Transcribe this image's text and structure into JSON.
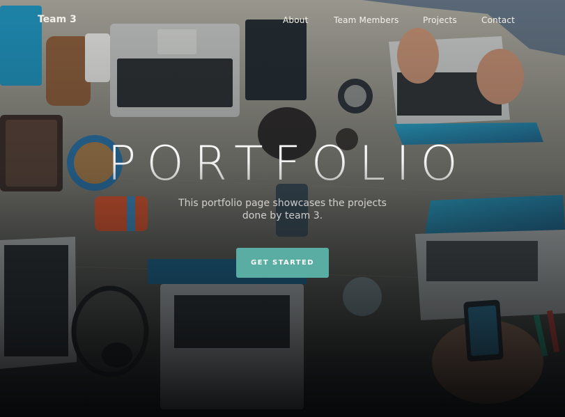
{
  "nav": {
    "brand": "Team 3",
    "links": [
      {
        "label": "About"
      },
      {
        "label": "Team Members"
      },
      {
        "label": "Projects"
      },
      {
        "label": "Contact"
      }
    ]
  },
  "hero": {
    "title": "PORTFOLIO",
    "subtitle": "This portfolio page showcases the projects done by team 3.",
    "cta_label": "GET STARTED"
  },
  "colors": {
    "accent": "#5aada3",
    "text_light": "#f4f1ea"
  }
}
